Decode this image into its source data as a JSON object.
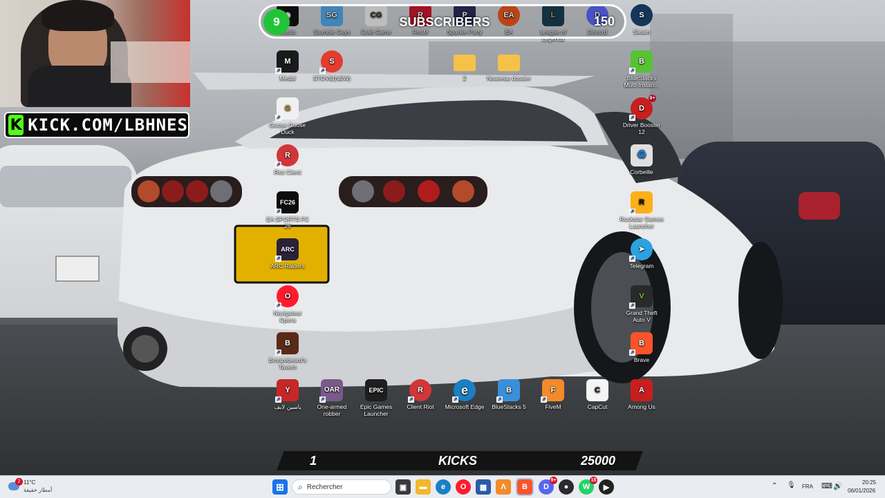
{
  "overlay": {
    "kick_banner": {
      "text": "KICK.COM/LBHNES",
      "logo_letter": "K"
    },
    "subscribers": {
      "count": "9",
      "label": "SUBSCRIBERS",
      "goal": "150"
    },
    "kicks_goal": {
      "current": "1",
      "label": "KICKS",
      "target": "25000"
    }
  },
  "desktop_icons": {
    "top_row": [
      {
        "label": "studio",
        "color": "#111111",
        "glyph": "◉"
      },
      {
        "label": "Stumble Guys",
        "color": "#4fa3e0",
        "glyph": "SG"
      },
      {
        "label": "Crab Game",
        "color": "#e7e7e7",
        "glyph": "CG"
      },
      {
        "label": "ReLM",
        "color": "#c5172c",
        "glyph": "R"
      },
      {
        "label": "Sparkle Party",
        "color": "#2a2a5a",
        "glyph": "P"
      },
      {
        "label": "EA",
        "color": "#e4531b",
        "glyph": "EA"
      },
      {
        "label": "League of Legends",
        "color": "#1a3b4e",
        "glyph": "L"
      },
      {
        "label": "Discord",
        "color": "#5865f2",
        "glyph": "D"
      },
      {
        "label": "Steam",
        "color": "#16355a",
        "glyph": "S"
      }
    ],
    "medal": {
      "label": "Medal",
      "color": "#1a1a1a",
      "glyph": "M"
    },
    "stove": {
      "label": "STOVE(NEW)",
      "color": "#e33b2e",
      "glyph": "S"
    },
    "folder_2": {
      "label": "2",
      "color": "#f5c247",
      "glyph": ""
    },
    "nouveau_dossier": {
      "label": "Nouveau dossier",
      "color": "#f5c247",
      "glyph": ""
    },
    "bluestacks_multi": {
      "label": "BlueStacks Multi-Instan...",
      "color": "#57c234",
      "glyph": "B"
    },
    "goose": {
      "label": "Goose Goose Duck",
      "color": "#f0f0f0",
      "glyph": "G"
    },
    "driver_booster": {
      "label": "Driver Booster 12",
      "color": "#c81e1e",
      "glyph": "D",
      "badge": "9+"
    },
    "riot_client_left": {
      "label": "Riot Client",
      "color": "#d13639",
      "glyph": "R"
    },
    "corbeille": {
      "label": "Corbeille",
      "color": "#ffffff",
      "glyph": "♻"
    },
    "fc26": {
      "label": "EA SPORTS FC 26",
      "color": "#0d0d0d",
      "glyph": "FC26"
    },
    "rockstar": {
      "label": "Rockstar Games Launcher",
      "color": "#fcaf17",
      "glyph": "R"
    },
    "arc_raiders": {
      "label": "ARC Raiders",
      "color": "#2a2238",
      "glyph": "ARC"
    },
    "telegram": {
      "label": "Telegram",
      "color": "#2aa3e0",
      "glyph": "➤"
    },
    "opera": {
      "label": "Navigateur Opera",
      "color": "#ff1b2d",
      "glyph": "O"
    },
    "gta": {
      "label": "Grand Theft Auto V",
      "color": "#2a2a2a",
      "glyph": "V"
    },
    "bronzebeard": {
      "label": "Bronzebeard's Tavern",
      "color": "#5a2a18",
      "glyph": "B"
    },
    "brave": {
      "label": "Brave",
      "color": "#fb542b",
      "glyph": "B"
    },
    "bottom_row": [
      {
        "label": "ياسين لايف",
        "color": "#c62828",
        "glyph": "Y"
      },
      {
        "label": "One-armed robber",
        "color": "#7a5a8a",
        "glyph": "OAR"
      },
      {
        "label": "Epic Games Launcher",
        "color": "#1e1e1e",
        "glyph": "EPIC"
      },
      {
        "label": "Client Riot",
        "color": "#d13639",
        "glyph": "R"
      },
      {
        "label": "Microsoft Edge",
        "color": "#1b7fc4",
        "glyph": "e"
      },
      {
        "label": "BlueStacks 5",
        "color": "#3a8fd9",
        "glyph": "B"
      },
      {
        "label": "FiveM",
        "color": "#f38a2c",
        "glyph": "F"
      },
      {
        "label": "CapCut",
        "color": "#f5f5f5",
        "glyph": "C"
      },
      {
        "label": "Among Us",
        "color": "#c91e1e",
        "glyph": "A"
      }
    ]
  },
  "taskbar": {
    "weather_temp": "11°C",
    "weather_desc": "أمطار خفيفة",
    "weather_badge": "2",
    "search_placeholder": "Rechercher",
    "apps": [
      {
        "name": "windows-start-icon",
        "color": "#1a73e8",
        "glyph": "⊞"
      },
      {
        "name": "task-view-icon",
        "color": "#3a3a3a",
        "glyph": "▣"
      },
      {
        "name": "file-explorer-icon",
        "color": "#f3b72c",
        "glyph": "▬"
      },
      {
        "name": "edge-icon",
        "color": "#1b7fc4",
        "glyph": "e"
      },
      {
        "name": "opera-icon",
        "color": "#ff1b2d",
        "glyph": "O"
      },
      {
        "name": "store-icon",
        "color": "#2b5aa8",
        "glyph": "▦"
      },
      {
        "name": "aimp-icon",
        "color": "#f38a2c",
        "glyph": "Λ"
      },
      {
        "name": "brave-icon",
        "color": "#fb542b",
        "glyph": "B"
      },
      {
        "name": "discord-icon",
        "color": "#5865f2",
        "glyph": "D",
        "badge": "9+"
      },
      {
        "name": "obs-icon",
        "color": "#2b2b2b",
        "glyph": "●"
      },
      {
        "name": "whatsapp-icon",
        "color": "#25d366",
        "glyph": "W",
        "badge": "15"
      },
      {
        "name": "media-player-icon",
        "color": "#222222",
        "glyph": "▶"
      }
    ],
    "language": "FRA",
    "time": "20:25",
    "date": "06/01/2026"
  }
}
